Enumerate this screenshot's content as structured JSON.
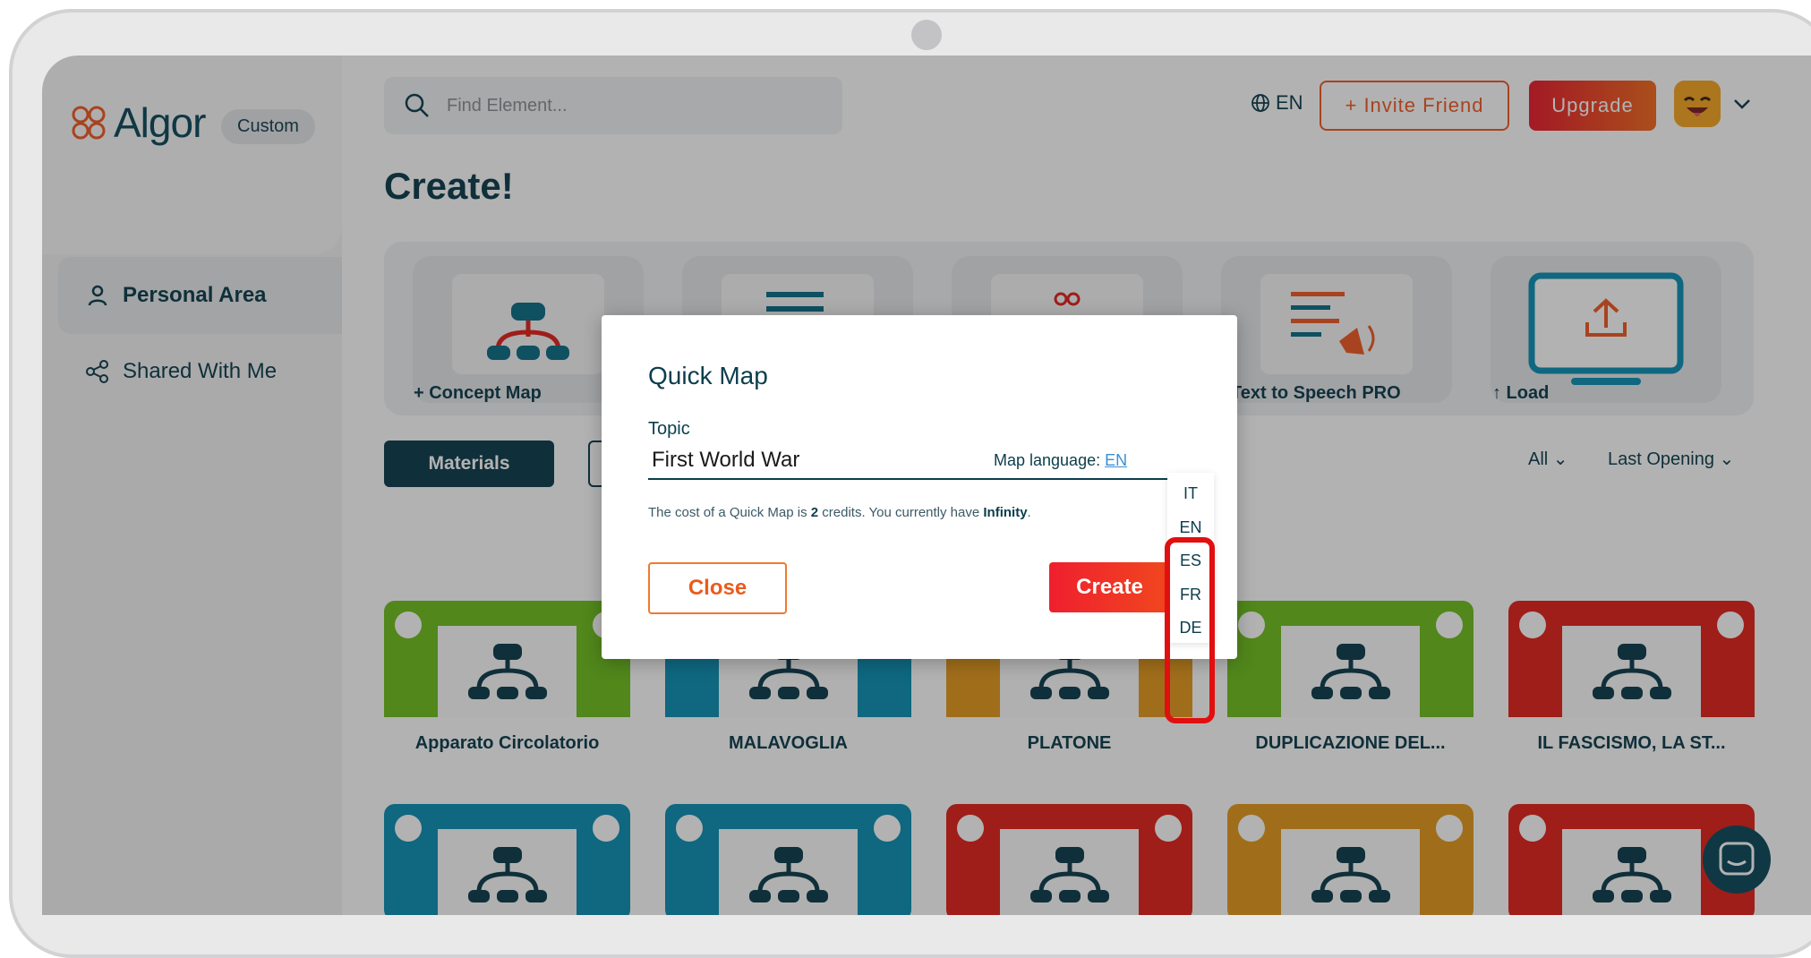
{
  "app": {
    "brand": "Algor",
    "plan_badge": "Custom",
    "search_placeholder": "Find Element...",
    "language": "EN",
    "invite_label": "+ Invite Friend",
    "upgrade_label": "Upgrade"
  },
  "sidebar": {
    "items": [
      {
        "label": "Personal Area"
      },
      {
        "label": "Shared With Me"
      }
    ]
  },
  "main": {
    "title": "Create!",
    "create_options": [
      {
        "label": "+ Concept Map"
      },
      {
        "label": ""
      },
      {
        "label": ""
      },
      {
        "label": "Text to Speech PRO"
      },
      {
        "label": "↑ Load"
      }
    ],
    "tabs": [
      {
        "label": "Materials"
      }
    ],
    "filter_all": "All",
    "filter_sort": "Last Opening",
    "cards": [
      {
        "title": "Apparato Circolatorio",
        "color": "#6fbf1f"
      },
      {
        "title": "MALAVOGLIA",
        "color": "#0d8fb5"
      },
      {
        "title": "PLATONE",
        "color": "#e49a1f"
      },
      {
        "title": "DUPLICAZIONE DEL...",
        "color": "#6fbf1f"
      },
      {
        "title": "IL FASCISMO, LA ST...",
        "color": "#e3231b"
      }
    ],
    "cards_row2_colors": [
      "#0d8fb5",
      "#0d8fb5",
      "#e3231b",
      "#e49a1f",
      "#e3231b"
    ]
  },
  "modal": {
    "title": "Quick Map",
    "topic_label": "Topic",
    "topic_value": "First World War",
    "map_language_label": "Map language: ",
    "map_language_value": "EN",
    "cost_prefix": "The cost of a Quick Map is ",
    "cost_value": "2",
    "cost_mid": " credits. You currently have ",
    "credits_value": "Infinity",
    "cost_suffix": ".",
    "close_label": "Close",
    "create_label": "Create",
    "language_options": [
      "IT",
      "EN",
      "ES",
      "FR",
      "DE"
    ]
  },
  "colors": {
    "primary_dark": "#0c3d4c",
    "accent_orange": "#f15a24",
    "accent_red": "#e3231b",
    "highlight": "#e10f0f"
  }
}
